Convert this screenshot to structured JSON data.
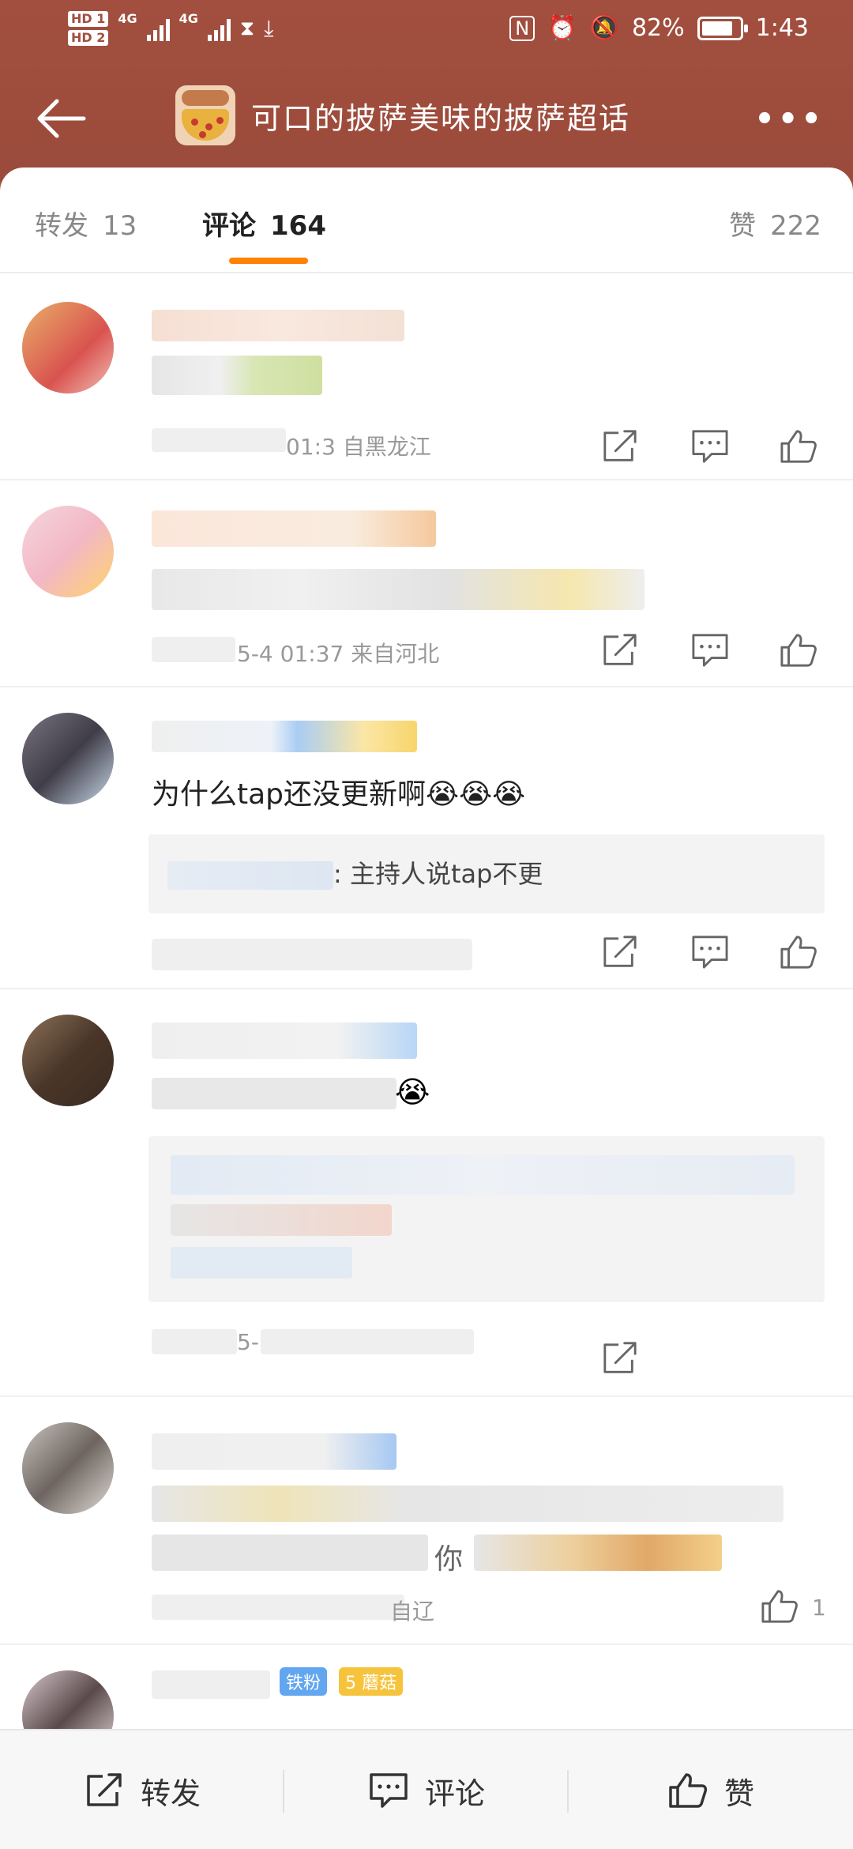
{
  "status_bar": {
    "hd1": "HD 1",
    "hd2": "HD 2",
    "net1": "4G",
    "net2": "4G",
    "battery": "82%",
    "battery_level": 0.82,
    "time": "1:43"
  },
  "header": {
    "title": "可口的披萨美味的披萨超话"
  },
  "tabs": [
    {
      "label": "转发",
      "count": "13"
    },
    {
      "label": "评论",
      "count": "164"
    },
    {
      "label": "赞",
      "count": "222"
    }
  ],
  "comments": [
    {
      "meta": "01:3 自黑龙江"
    },
    {
      "meta": "5-4  01:37  来自河北"
    },
    {
      "text": "为什么tap还没更新啊😭😭😭",
      "quote": ": 主持人说tap不更"
    },
    {
      "meta": "5-"
    },
    {
      "text_fragment": "你",
      "meta": "自辽",
      "like_count": "1"
    },
    {
      "badges": [
        "铁粉",
        "5 蘑菇"
      ]
    }
  ],
  "bottom_bar": {
    "repost": "转发",
    "comment": "评论",
    "like": "赞"
  },
  "colors": {
    "header_bg": "#a24f3f",
    "accent": "#ff8200"
  }
}
